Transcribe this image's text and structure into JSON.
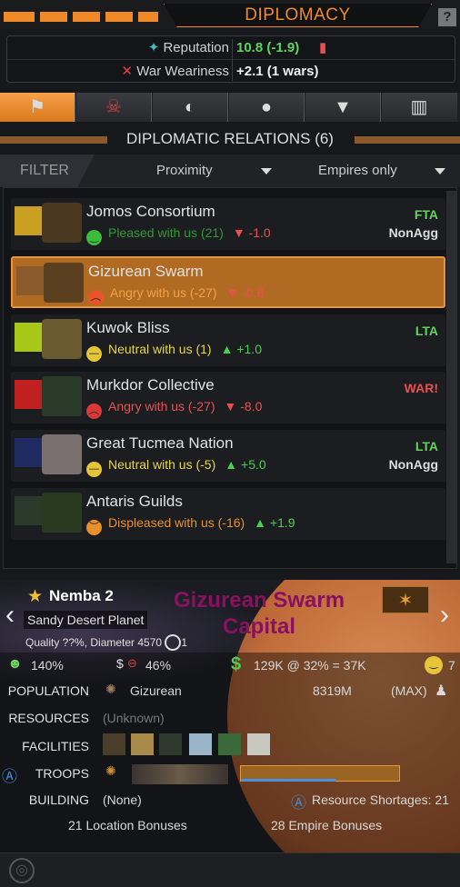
{
  "header": {
    "title": "DIPLOMACY",
    "help": "?"
  },
  "reputation": {
    "label": "Reputation",
    "value": "10.8 (-1.9)",
    "war_label": "War Weariness",
    "war_value": "+2.1 (1 wars)"
  },
  "section": {
    "title": "DIPLOMATIC RELATIONS (6)"
  },
  "filter": {
    "label": "FILTER",
    "sort": "Proximity",
    "scope": "Empires only"
  },
  "empires": [
    {
      "name": "Jomos Consortium",
      "mood": "Pleased with us (21)",
      "trend": "-1.0",
      "treaty": "FTA",
      "treaty2": "NonAgg",
      "mood_color": "#2f9a34",
      "face_color": "#3cbc3c"
    },
    {
      "name": "Gizurean Swarm",
      "mood": "Angry with us (-27)",
      "trend": "-0.8",
      "treaty": "",
      "treaty2": "",
      "mood_color": "#f3a04a",
      "face_color": "#e8542a"
    },
    {
      "name": "Kuwok Bliss",
      "mood": "Neutral with us (1)",
      "trend": "+1.0",
      "treaty": "LTA",
      "treaty2": "",
      "mood_color": "#e6d64a",
      "face_color": "#e6c53a"
    },
    {
      "name": "Murkdor Collective",
      "mood": "Angry with us (-27)",
      "trend": "-8.0",
      "treaty": "WAR!",
      "treaty2": "",
      "mood_color": "#e85050",
      "face_color": "#d93838"
    },
    {
      "name": "Great Tucmea Nation",
      "mood": "Neutral with us (-5)",
      "trend": "+5.0",
      "treaty": "LTA",
      "treaty2": "NonAgg",
      "mood_color": "#e6d64a",
      "face_color": "#e6c53a"
    },
    {
      "name": "Antaris Guilds",
      "mood": "Displeased with us (-16)",
      "trend": "+1.9",
      "treaty": "",
      "treaty2": "",
      "mood_color": "#e8902c",
      "face_color": "#e8902c"
    }
  ],
  "planet": {
    "name": "Nemba 2",
    "type": "Sandy Desert Planet",
    "quality": "Quality ??%, Diameter 4570",
    "quality_count": "1",
    "capital_line1": "Gizurean Swarm",
    "capital_line2": "Capital",
    "happiness": "140%",
    "tax": "46%",
    "income": "129K @ 32% = 37K",
    "mood_count": "7",
    "population_label": "POPULATION",
    "race": "Gizurean",
    "pop": "8319M",
    "pop_max": "(MAX)",
    "resources_label": "RESOURCES",
    "resources": "(Unknown)",
    "facilities_label": "FACILITIES",
    "troops_label": "TROOPS",
    "building_label": "BUILDING",
    "building": "(None)",
    "shortages": "Resource Shortages: 21",
    "loc_bonus": "21 Location Bonuses",
    "emp_bonus": "28 Empire Bonuses"
  }
}
